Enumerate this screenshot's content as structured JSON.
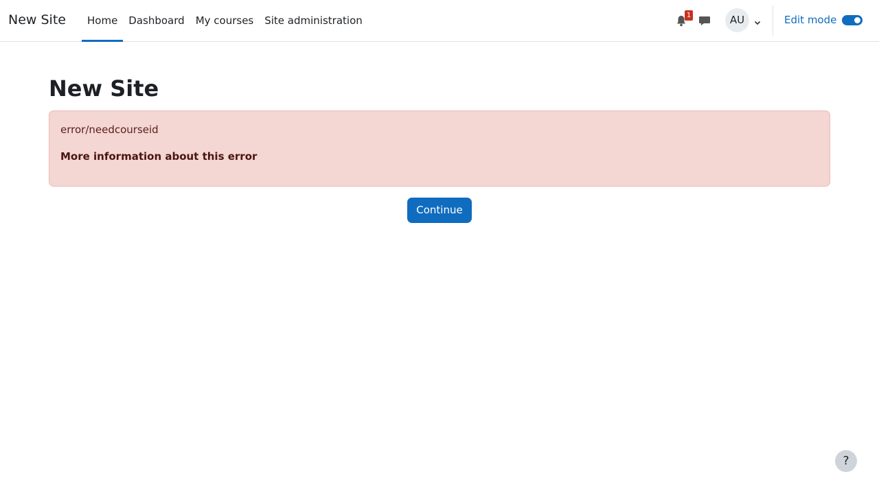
{
  "navbar": {
    "brand": "New Site",
    "nav_items": [
      {
        "label": "Home",
        "active": true
      },
      {
        "label": "Dashboard",
        "active": false
      },
      {
        "label": "My courses",
        "active": false
      },
      {
        "label": "Site administration",
        "active": false
      }
    ],
    "notification_count": "1",
    "user_initials": "AU",
    "edit_mode_label": "Edit mode",
    "edit_mode_on": true,
    "icons": {
      "notifications": "bell-icon",
      "messages": "chat-bubble-icon",
      "user_menu": "chevron-down-icon"
    }
  },
  "main": {
    "page_title": "New Site",
    "error": {
      "message": "error/needcourseid",
      "more_info_link": "More information about this error"
    },
    "continue_label": "Continue"
  },
  "help_label": "?",
  "colors": {
    "primary": "#0f6cbf",
    "alert_background": "#f4d6d2",
    "alert_border": "#eebbb6",
    "alert_text": "#5a1d1d",
    "badge": "#ca3120"
  }
}
